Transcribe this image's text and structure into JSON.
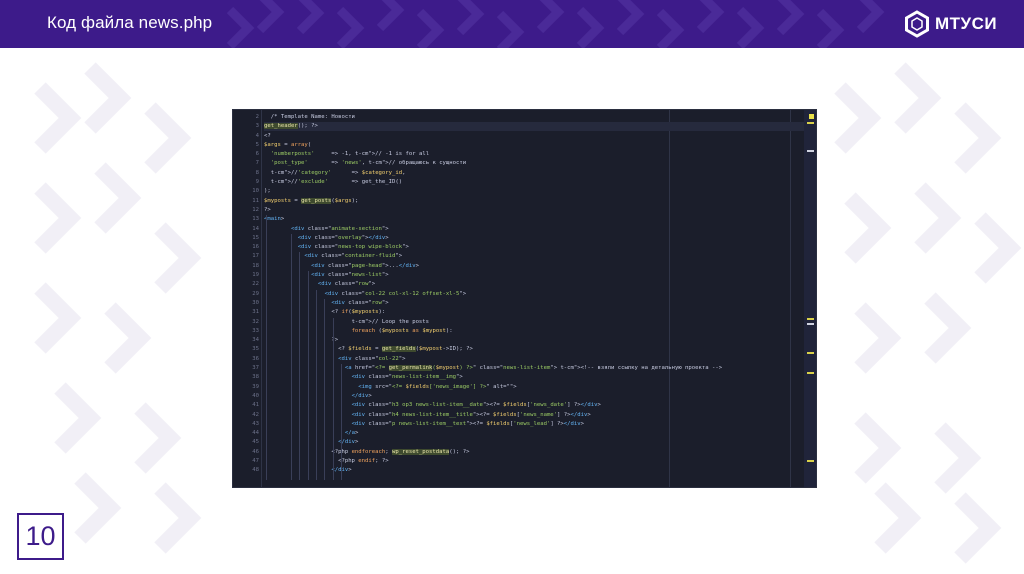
{
  "slide": {
    "title": "Код файла news.php",
    "page_number": "10"
  },
  "logo": {
    "text": "МТУСИ",
    "icon": "hexagon-ring-icon"
  },
  "colors": {
    "brand": "#3d1b8a",
    "code_background": "#1b1e2b"
  },
  "code": {
    "line_numbers": [
      "2",
      "3",
      "4",
      "5",
      "6",
      "7",
      "8",
      "9",
      "10",
      "11",
      "12",
      "13",
      "14",
      "15",
      "16",
      "17",
      "18",
      "19",
      "22",
      "29",
      "30",
      "31",
      "32",
      "33",
      "34",
      "35",
      "36",
      "37",
      "38",
      "39",
      "40",
      "41",
      "42",
      "43",
      "44",
      "45",
      "46",
      "47",
      "48"
    ],
    "lines": [
      "  /* Template Name: Новости",
      "get_header(); ?>",
      "<?",
      "$args = array(",
      "  'numberposts'     => -1, // -1 is for all",
      "  'post_type'       => 'news', // обращаюсь к сущности",
      "  //'category'      => $category_id,",
      "  //'exclude'       => get_the_ID()",
      ");",
      "$myposts = get_posts($args);",
      "?>",
      "<main>",
      "        <div class=\"animate-section\">",
      "          <div class=\"overlay\"></div>",
      "          <div class=\"news-top wipe-block\">",
      "            <div class=\"container-fluid\">",
      "              <div class=\"page-head\">...</div>",
      "              <div class=\"news-list\">",
      "                <div class=\"row\">",
      "                  <div class=\"col-22 col-xl-12 offset-xl-5\">",
      "                    <div class=\"row\">",
      "                    <? if($myposts):",
      "                          // Loop the posts",
      "                          foreach ($myposts as $mypost):",
      "                    ?>",
      "                      <? $fields = get_fields($mypost->ID); ?>",
      "                      <div class=\"col-22\">",
      "                        <a href=\"<?= get_permalink($mypost) ?>\" class=\"news-list-item\"> <!-- взяли ссылку на детальную проекта -->",
      "                          <div class=\"news-list-item__img\">",
      "                            <img src=\"<?= $fields['news_image'] ?>\" alt=\"\">",
      "                          </div>",
      "                          <div class=\"h3 op3 news-list-item__date\"><?= $fields['news_date'] ?></div>",
      "                          <div class=\"h4 news-list-item__title\"><?= $fields['news_name'] ?></div>",
      "                          <div class=\"p news-list-item__text\"><?= $fields['news_lead'] ?></div>",
      "                        </a>",
      "                      </div>",
      "                    <?php endforeach; wp_reset_postdata(); ?>",
      "                      <?php endif; ?>",
      "                    </div>"
    ]
  }
}
